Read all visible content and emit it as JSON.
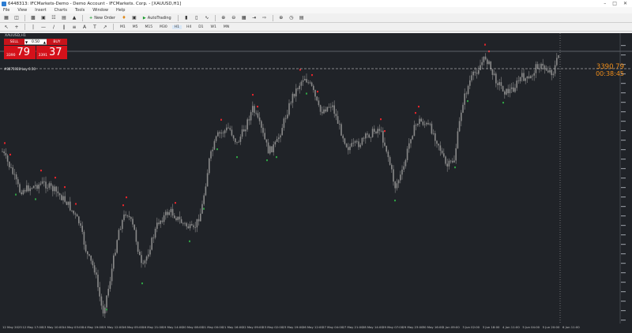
{
  "window": {
    "title": "6448313: IFCMarkets-Demo - Demo Account - IFCMarkets. Corp. - [XAUUSD,H1]"
  },
  "menu": [
    "File",
    "View",
    "Insert",
    "Charts",
    "Tools",
    "Window",
    "Help"
  ],
  "toolbar": {
    "new_order": "New Order",
    "auto_trading": "AutoTrading",
    "timeframes": [
      "M1",
      "M5",
      "M15",
      "M30",
      "H1",
      "H4",
      "D1",
      "W1",
      "MN"
    ],
    "active_timeframe": "H1"
  },
  "chart": {
    "symbol_title": "XAUUSD,H1",
    "ea_label": "#8875928 buy 0.50",
    "current_price": "3390.79",
    "countdown": "00:38:45",
    "colors": {
      "background": "#202328",
      "candles": "#8a8a8a",
      "sell_signal": "#e0242b",
      "buy_signal": "#2ea043",
      "price_label": "#f08e1a"
    }
  },
  "trade_panel": {
    "sell_label": "SELL",
    "buy_label": "BUY",
    "volume": "0.50",
    "sell_price_small": "3390",
    "sell_price_big": "79",
    "buy_price_small": "3391",
    "buy_price_big": "37"
  },
  "time_axis": [
    "12 May 2025",
    "12 May 17:00",
    "13 May 10:00",
    "14 May 03:00",
    "14 May 19:00",
    "15 May 12:00",
    "16 May 05:00",
    "16 May 21:00",
    "19 May 14:00",
    "20 May 08:00",
    "21 May 00:00",
    "21 May 16:00",
    "22 May 09:00",
    "23 May 02:00",
    "23 May 19:00",
    "26 May 12:00",
    "27 May 04:00",
    "27 May 21:00",
    "28 May 14:00",
    "29 May 07:00",
    "29 May 23:00",
    "30 May 16:00",
    "2 Jun 09:00",
    "3 Jun 02:00",
    "3 Jun 18:00",
    "4 Jun 11:00",
    "5 Jun 04:00",
    "5 Jun 20:00",
    "6 Jun 11:00"
  ]
}
